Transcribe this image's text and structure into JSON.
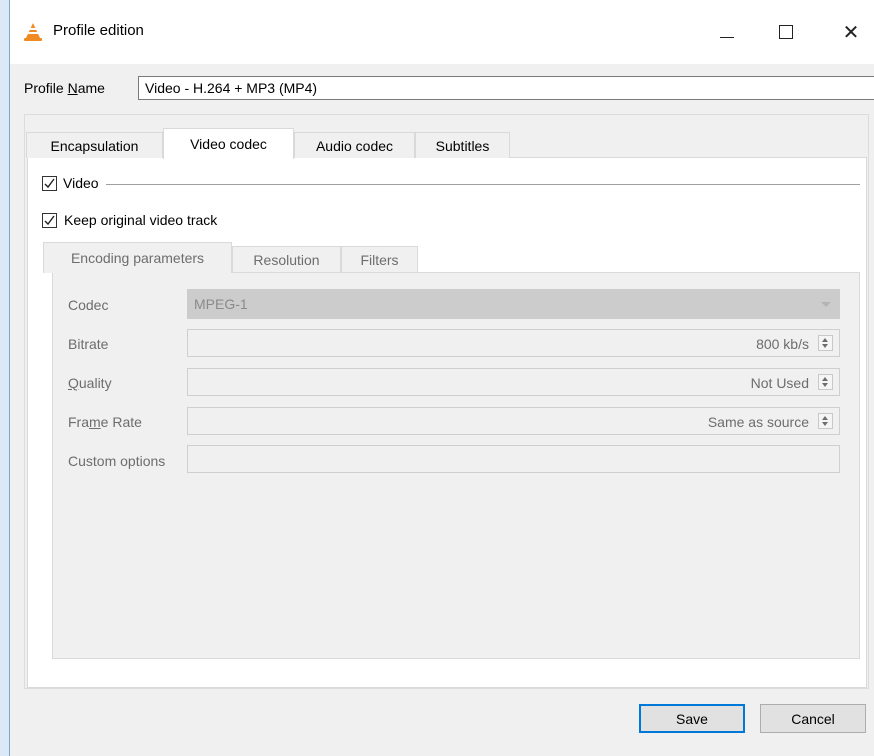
{
  "window": {
    "title": "Profile edition",
    "close_glyph": "✕"
  },
  "profile": {
    "label_pre": "Profile ",
    "label_accel": "N",
    "label_post": "ame",
    "value": "Video - H.264 + MP3 (MP4)"
  },
  "tabs": [
    "Encapsulation",
    "Video codec",
    "Audio codec",
    "Subtitles"
  ],
  "video": {
    "enable_label": "Video",
    "keep_label": "Keep original video track",
    "inner_tabs": [
      "Encoding parameters",
      "Resolution",
      "Filters"
    ],
    "codec": {
      "label": "Codec",
      "value": "MPEG-1"
    },
    "bitrate": {
      "label": "Bitrate",
      "value": "800 kb/s"
    },
    "quality": {
      "label_accel": "Q",
      "label_rest": "uality",
      "value": "Not Used"
    },
    "frame_rate": {
      "label_pre": "Fra",
      "label_accel": "m",
      "label_post": "e Rate",
      "value": "Same as source"
    },
    "custom_options": {
      "label": "Custom options",
      "value": ""
    }
  },
  "buttons": {
    "save": "Save",
    "cancel": "Cancel"
  },
  "colors": {
    "accent": "#0078d7",
    "vlc_orange": "#f08a24"
  }
}
